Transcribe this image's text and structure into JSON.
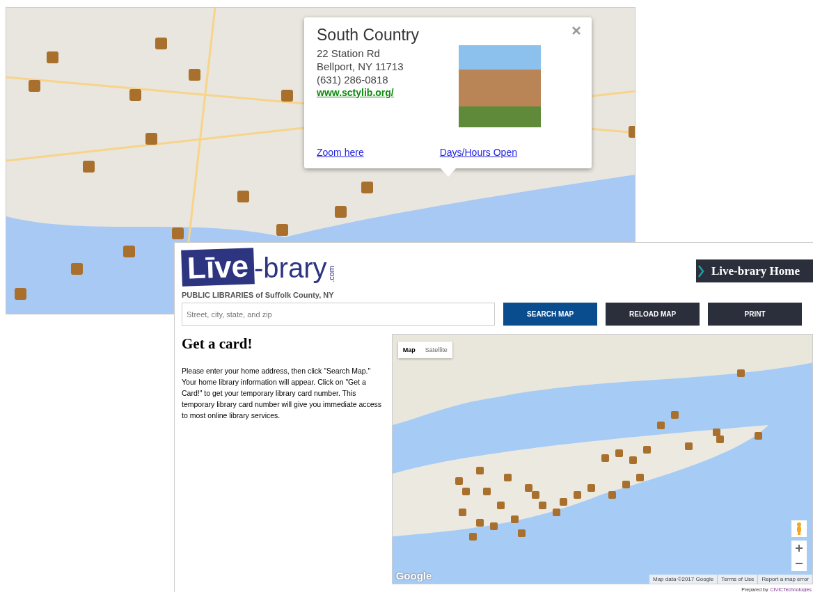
{
  "map_view": {
    "popup": {
      "title": "South Country",
      "address_line_1": "22 Station Rd",
      "address_line_2": "Bellport, NY 11713",
      "phone": "(631) 286-0818",
      "website": "www.sctylib.org/",
      "links": [
        "Zoom here",
        "Days/Hours Open"
      ]
    }
  },
  "page": {
    "logo": {
      "mark": "Līve",
      "word": "-brary",
      "suffix": ".com"
    },
    "subtitle": "PUBLIC LIBRARIES of Suffolk County, NY",
    "home_link": "Live-brary Home",
    "search": {
      "placeholder": "Street, city, state, and zip"
    },
    "buttons": [
      {
        "label": "SEARCH MAP",
        "kind": "primary"
      },
      {
        "label": "RELOAD MAP",
        "kind": "dark"
      },
      {
        "label": "PRINT",
        "kind": "dark"
      }
    ],
    "heading": "Get a card!",
    "intro": "Please enter your home address, then click \"Search Map.\" Your home library information will appear. Click on \"Get a Card!\" to get your temporary library card number. This temporary library card number will give you immediate access to most online library services.",
    "map": {
      "type_tabs": [
        {
          "label": "Map",
          "selected": true
        },
        {
          "label": "Satellite",
          "selected": false
        }
      ],
      "brand": "Google",
      "attribution": [
        "Map data ©2017 Google",
        "Terms of Use",
        "Report a map error"
      ]
    },
    "credit": {
      "prefix": "Prepared by",
      "company": "CIVICTechnologies"
    }
  }
}
